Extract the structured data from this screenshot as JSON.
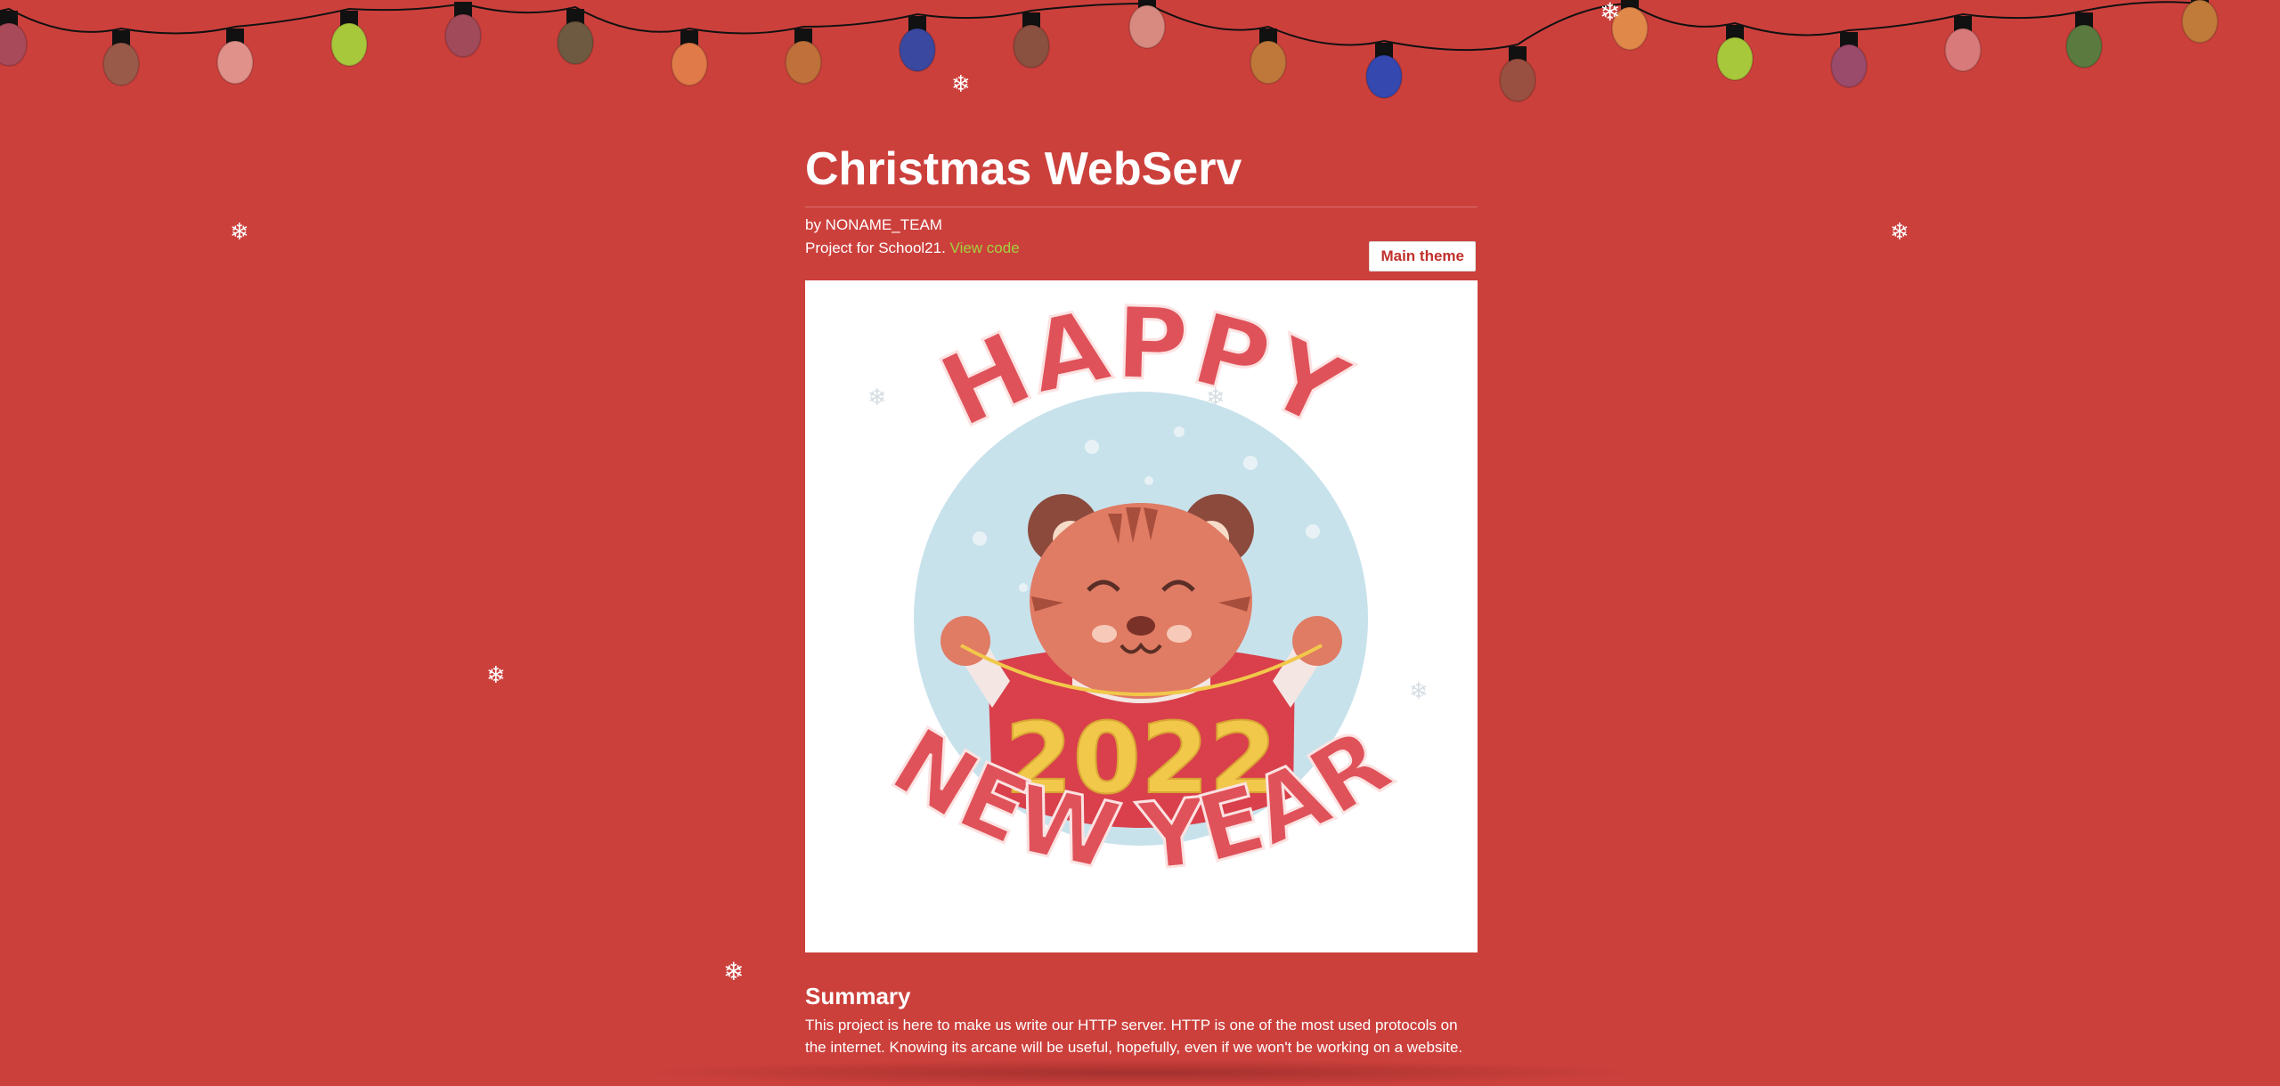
{
  "header": {
    "title": "Christmas WebServ",
    "byline": "by NONAME_TEAM",
    "project_prefix": "Project for School21.",
    "view_code_label": "View code",
    "theme_button_label": "Main theme"
  },
  "hero": {
    "top_text": "HAPPY",
    "year_text": "2022",
    "bottom_text": "NEW YEAR"
  },
  "summary": {
    "title": "Summary",
    "text": "This project is here to make us write our HTTP server. HTTP is one of the most used protocols on the internet. Knowing its arcane will be useful, hopefully, even if we won't be working on a website."
  },
  "snowflake_glyph": "❄",
  "colors": {
    "background": "#cc403c",
    "link": "#a4d13e",
    "button_text": "#c0302c",
    "hero_red": "#e0525a",
    "hero_gold": "#f1c84a"
  },
  "lights_colors": [
    "#a94a5a",
    "#9a5a4a",
    "#e0918a",
    "#a8c83c",
    "#a04a5a",
    "#6e5a40",
    "#e07a48",
    "#c0703a",
    "#3a48a0",
    "#8a5040",
    "#d88a80",
    "#c0783a",
    "#3448b0",
    "#9a5040",
    "#e0884a",
    "#a8c83c",
    "#9a4a6a",
    "#d87a7a",
    "#5a7a40",
    "#c07a3a"
  ]
}
